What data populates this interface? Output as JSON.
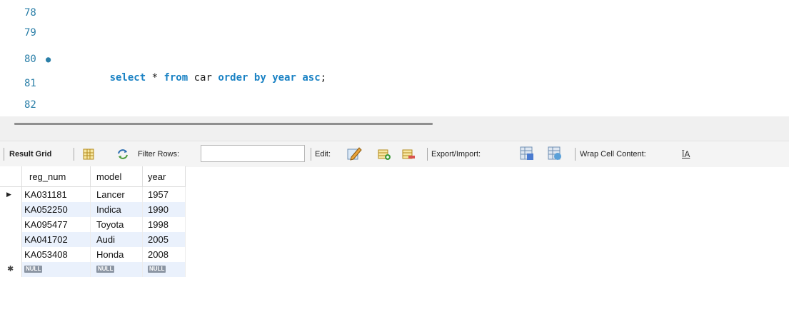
{
  "editor": {
    "lines": [
      {
        "num": "78",
        "code": ""
      },
      {
        "num": "79",
        "code": ""
      },
      {
        "num": "80",
        "marker": "●",
        "tokens": [
          {
            "t": "select",
            "k": "kw"
          },
          {
            "t": " * ",
            "k": "plain"
          },
          {
            "t": "from",
            "k": "kw"
          },
          {
            "t": " car ",
            "k": "plain"
          },
          {
            "t": "order by",
            "k": "kw"
          },
          {
            "t": " ",
            "k": "plain"
          },
          {
            "t": "year",
            "k": "kw"
          },
          {
            "t": " ",
            "k": "plain"
          },
          {
            "t": "asc",
            "k": "kw"
          },
          {
            "t": ";",
            "k": "plain"
          }
        ]
      },
      {
        "num": "81",
        "code": ""
      },
      {
        "num": "82",
        "code": ""
      }
    ]
  },
  "toolbar": {
    "result_grid": "Result Grid",
    "filter_rows": "Filter Rows:",
    "filter_value": "",
    "edit": "Edit:",
    "export_import": "Export/Import:",
    "wrap": "Wrap Cell Content:",
    "wrap_glyph": "ĪA"
  },
  "grid": {
    "columns": [
      "reg_num",
      "model",
      "year"
    ],
    "rows": [
      [
        "KA031181",
        "Lancer",
        "1957"
      ],
      [
        "KA052250",
        "Indica",
        "1990"
      ],
      [
        "KA095477",
        "Toyota",
        "1998"
      ],
      [
        "KA041702",
        "Audi",
        "2005"
      ],
      [
        "KA053408",
        "Honda",
        "2008"
      ]
    ],
    "null_label": "NULL",
    "current_row_marker": "▶",
    "new_row_marker": "✱"
  },
  "colors": {
    "keyword": "#1a82c4",
    "line_number": "#2b7fa8",
    "alt_row": "#eaf1fc"
  }
}
